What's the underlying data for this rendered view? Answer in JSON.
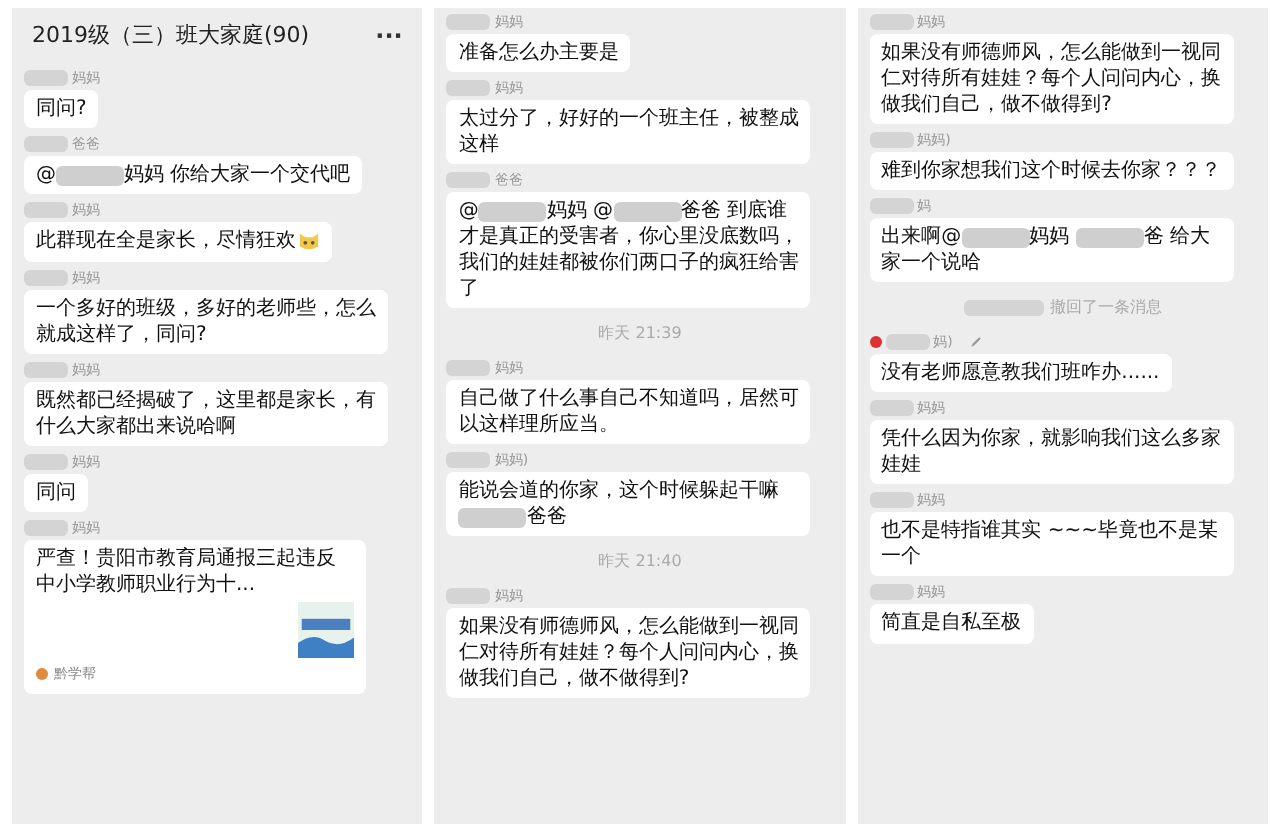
{
  "panels": [
    {
      "title": "2019级（三）班大家庭(90)",
      "menu": "···",
      "items": [
        {
          "kind": "msg",
          "sender": "妈妈",
          "parts": [
            {
              "kind": "text",
              "text": "同问?"
            }
          ]
        },
        {
          "kind": "msg",
          "sender": "爸爸",
          "parts": [
            {
              "kind": "text",
              "text": "@"
            },
            {
              "kind": "blur"
            },
            {
              "kind": "text",
              "text": "妈妈 你给大家一个交代吧"
            }
          ]
        },
        {
          "kind": "msg",
          "sender": "妈妈",
          "emoji": true,
          "parts": [
            {
              "kind": "text",
              "text": "此群现在全是家长，尽情狂欢"
            }
          ]
        },
        {
          "kind": "msg",
          "sender": "妈妈",
          "parts": [
            {
              "kind": "text",
              "text": "一个多好的班级，多好的老师些，怎么就成这样了，同问?"
            }
          ]
        },
        {
          "kind": "msg",
          "sender": "妈妈",
          "parts": [
            {
              "kind": "text",
              "text": "既然都已经揭破了，这里都是家长，有什么大家都出来说哈啊"
            }
          ]
        },
        {
          "kind": "msg",
          "sender": "妈妈",
          "parts": [
            {
              "kind": "text",
              "text": "同问"
            }
          ]
        },
        {
          "kind": "card",
          "sender": "妈妈",
          "text": "严查！贵阳市教育局通报三起违反中小学教师职业行为十...",
          "source": "黔学帮"
        }
      ]
    },
    {
      "items": [
        {
          "kind": "msg",
          "sender": "妈妈",
          "parts": [
            {
              "kind": "text",
              "text": "准备怎么办主要是"
            }
          ]
        },
        {
          "kind": "msg",
          "sender": "妈妈",
          "parts": [
            {
              "kind": "text",
              "text": "太过分了，好好的一个班主任，被整成这样"
            }
          ]
        },
        {
          "kind": "msg",
          "sender": "爸爸",
          "parts": [
            {
              "kind": "text",
              "text": "@"
            },
            {
              "kind": "blur"
            },
            {
              "kind": "text",
              "text": "妈妈 @"
            },
            {
              "kind": "blur"
            },
            {
              "kind": "text",
              "text": "爸爸 到底谁才是真正的受害者，你心里没底数吗，我们的娃娃都被你们两口子的疯狂给害了"
            }
          ]
        },
        {
          "kind": "time",
          "text": "昨天 21:39"
        },
        {
          "kind": "msg",
          "sender": "妈妈",
          "parts": [
            {
              "kind": "text",
              "text": "自己做了什么事自己不知道吗，居然可以这样理所应当。"
            }
          ]
        },
        {
          "kind": "msg",
          "sender": "妈妈)",
          "parts": [
            {
              "kind": "text",
              "text": "能说会道的你家，这个时候躲起干嘛"
            },
            {
              "kind": "blur"
            },
            {
              "kind": "text",
              "text": "爸爸"
            }
          ]
        },
        {
          "kind": "time",
          "text": "昨天 21:40"
        },
        {
          "kind": "msg",
          "sender": "妈妈",
          "parts": [
            {
              "kind": "text",
              "text": "如果没有师德师风，怎么能做到一视同仁对待所有娃娃？每个人问问内心，换做我们自己，做不做得到?"
            }
          ]
        }
      ]
    },
    {
      "items": [
        {
          "kind": "msg",
          "sender": "妈妈",
          "parts": [
            {
              "kind": "text",
              "text": "如果没有师德师风，怎么能做到一视同仁对待所有娃娃？每个人问问内心，换做我们自己，做不做得到?"
            }
          ]
        },
        {
          "kind": "msg",
          "sender": "妈妈)",
          "parts": [
            {
              "kind": "text",
              "text": "难到你家想我们这个时候去你家？？？"
            }
          ]
        },
        {
          "kind": "msg",
          "sender": "妈",
          "parts": [
            {
              "kind": "text",
              "text": "出来啊@"
            },
            {
              "kind": "blur"
            },
            {
              "kind": "text",
              "text": "妈妈 "
            },
            {
              "kind": "blur"
            },
            {
              "kind": "text",
              "text": "爸 给大家一个说哈"
            }
          ]
        },
        {
          "kind": "notice",
          "text": "撤回了一条消息"
        },
        {
          "kind": "msg",
          "sender": "妈)",
          "badge": true,
          "parts": [
            {
              "kind": "text",
              "text": "没有老师愿意教我们班咋办......"
            }
          ]
        },
        {
          "kind": "msg",
          "sender": "妈妈",
          "parts": [
            {
              "kind": "text",
              "text": "凭什么因为你家，就影响我们这么多家娃娃"
            }
          ]
        },
        {
          "kind": "msg",
          "sender": "妈妈",
          "parts": [
            {
              "kind": "text",
              "text": "也不是特指谁其实 ~~~毕竟也不是某一个"
            }
          ]
        },
        {
          "kind": "msg",
          "sender": "妈妈",
          "parts": [
            {
              "kind": "text",
              "text": "简直是自私至极"
            }
          ]
        }
      ]
    }
  ]
}
